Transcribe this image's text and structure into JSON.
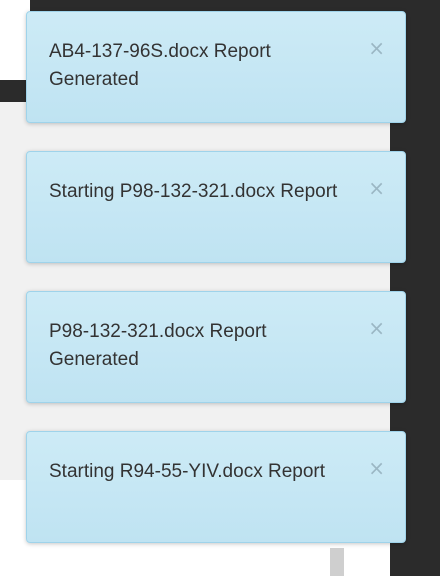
{
  "toasts": [
    {
      "message": "AB4-137-96S.docx Report Generated",
      "close_icon": "×"
    },
    {
      "message": "Starting P98-132-321.docx Report",
      "close_icon": "×"
    },
    {
      "message": "P98-132-321.docx Report Generated",
      "close_icon": "×"
    },
    {
      "message": "Starting R94-55-YIV.docx Report",
      "close_icon": "×"
    }
  ],
  "colors": {
    "toast_background": "#c8e8f5",
    "toast_border": "#9fd3ea",
    "toast_text": "#333333",
    "close_icon": "#9bb7c4",
    "app_dark": "#2b2b2b",
    "app_panel": "#f1f1f1"
  }
}
